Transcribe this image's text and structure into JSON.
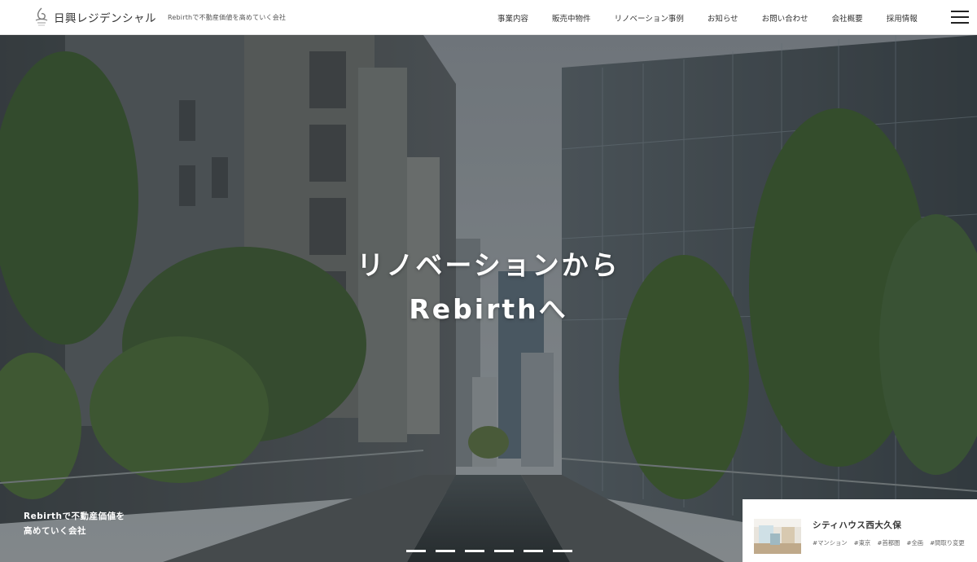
{
  "header": {
    "logo_text": "日興レジデンシャル",
    "tagline": "Rebirthで不動産価値を高めていく会社",
    "nav": [
      "事業内容",
      "販売中物件",
      "リノベーション事例",
      "お知らせ",
      "お問い合わせ",
      "会社概要",
      "採用情報"
    ]
  },
  "hero": {
    "title_line1": "リノベーションから",
    "title_line2": "Rebirthへ",
    "sub_line1": "Rebirthで不動産価値を",
    "sub_line2": "高めていく会社",
    "slides": 6
  },
  "property": {
    "title": "シティハウス西大久保",
    "tags": [
      "#マンション",
      "#東京",
      "#首都圏",
      "#全画",
      "#間取り変更"
    ]
  },
  "colors": {
    "header_bg": "#ffffff",
    "text": "#333333",
    "hero_overlay": "#3b4246"
  }
}
